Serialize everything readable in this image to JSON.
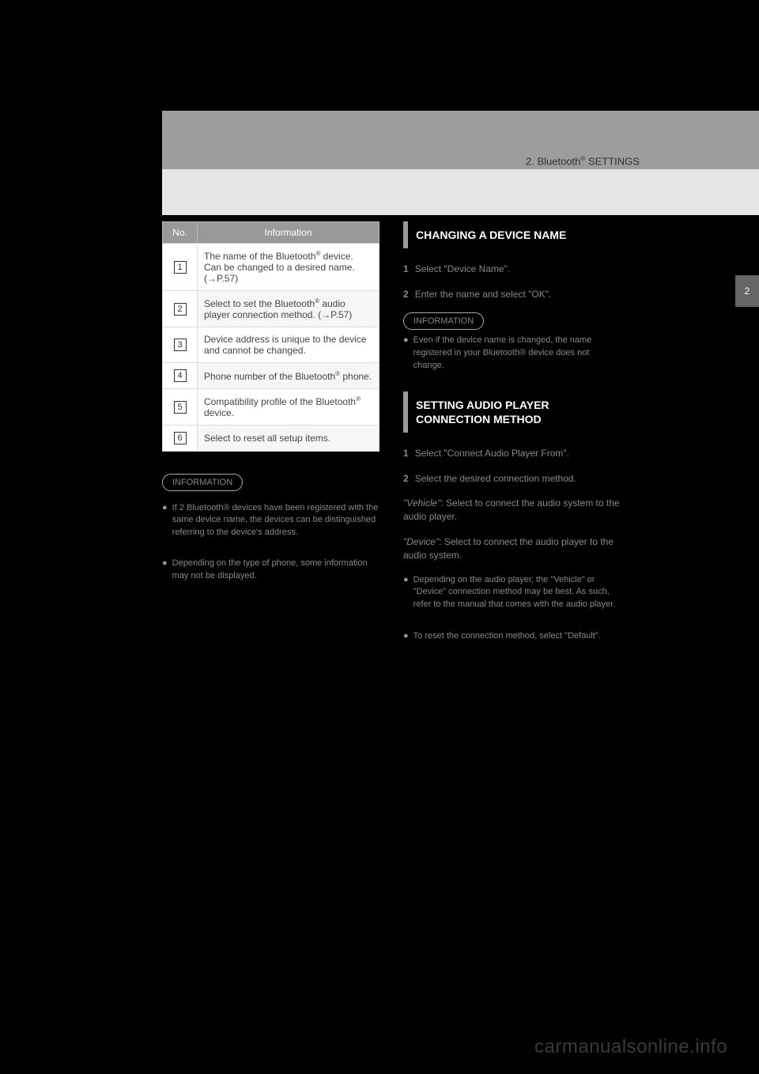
{
  "header": {
    "breadcrumb_prefix": "2. Bluetooth",
    "breadcrumb_suffix": " SETTINGS"
  },
  "sidetab": {
    "label": "2"
  },
  "table": {
    "headers": {
      "no": "No.",
      "info": "Information"
    },
    "rows": [
      {
        "num": "1",
        "text_before": "The name of the Bluetooth",
        "text_after": " device. Can be changed to a desired name. (→P.57)",
        "has_reg": true
      },
      {
        "num": "2",
        "text_before": "Select to set the Bluetooth",
        "text_after": " audio player connection method. (→P.57)",
        "has_reg": true
      },
      {
        "num": "3",
        "text_before": "Device address is unique to the device and cannot be changed.",
        "text_after": "",
        "has_reg": false
      },
      {
        "num": "4",
        "text_before": "Phone number of the Bluetooth",
        "text_after": " phone.",
        "has_reg": true
      },
      {
        "num": "5",
        "text_before": "Compatibility profile of the Bluetooth",
        "text_after": " device.",
        "has_reg": true
      },
      {
        "num": "6",
        "text_before": "Select to reset all setup items.",
        "text_after": "",
        "has_reg": false
      }
    ]
  },
  "leftinfo": {
    "label": "INFORMATION",
    "items": [
      "If 2 Bluetooth® devices have been registered with the same device name, the devices can be distinguished referring to the device's address.",
      "Depending on the type of phone, some information may not be displayed."
    ]
  },
  "right": {
    "section1": {
      "title": "CHANGING A DEVICE NAME",
      "steps": [
        {
          "n": "1",
          "t": "Select \"Device Name\"."
        },
        {
          "n": "2",
          "t": "Enter the name and select \"OK\"."
        }
      ],
      "info_label": "INFORMATION",
      "note": "Even if the device name is changed, the name registered in your Bluetooth® device does not change."
    },
    "section2": {
      "title": "SETTING AUDIO PLAYER CONNECTION METHOD",
      "steps": [
        {
          "n": "1",
          "t": "Select \"Connect Audio Player From\"."
        },
        {
          "n": "2",
          "t": "Select the desired connection method."
        }
      ],
      "methods": [
        {
          "label": "\"Vehicle\"",
          "desc": ": Select to connect the audio system to the audio player."
        },
        {
          "label": "\"Device\"",
          "desc": ": Select to connect the audio player to the audio system."
        }
      ],
      "notes": [
        "Depending on the audio player, the \"Vehicle\" or \"Device\" connection method may be best. As such, refer to the manual that comes with the audio player.",
        "To reset the connection method, select \"Default\"."
      ]
    }
  },
  "watermark": "carmanualsonline.info"
}
